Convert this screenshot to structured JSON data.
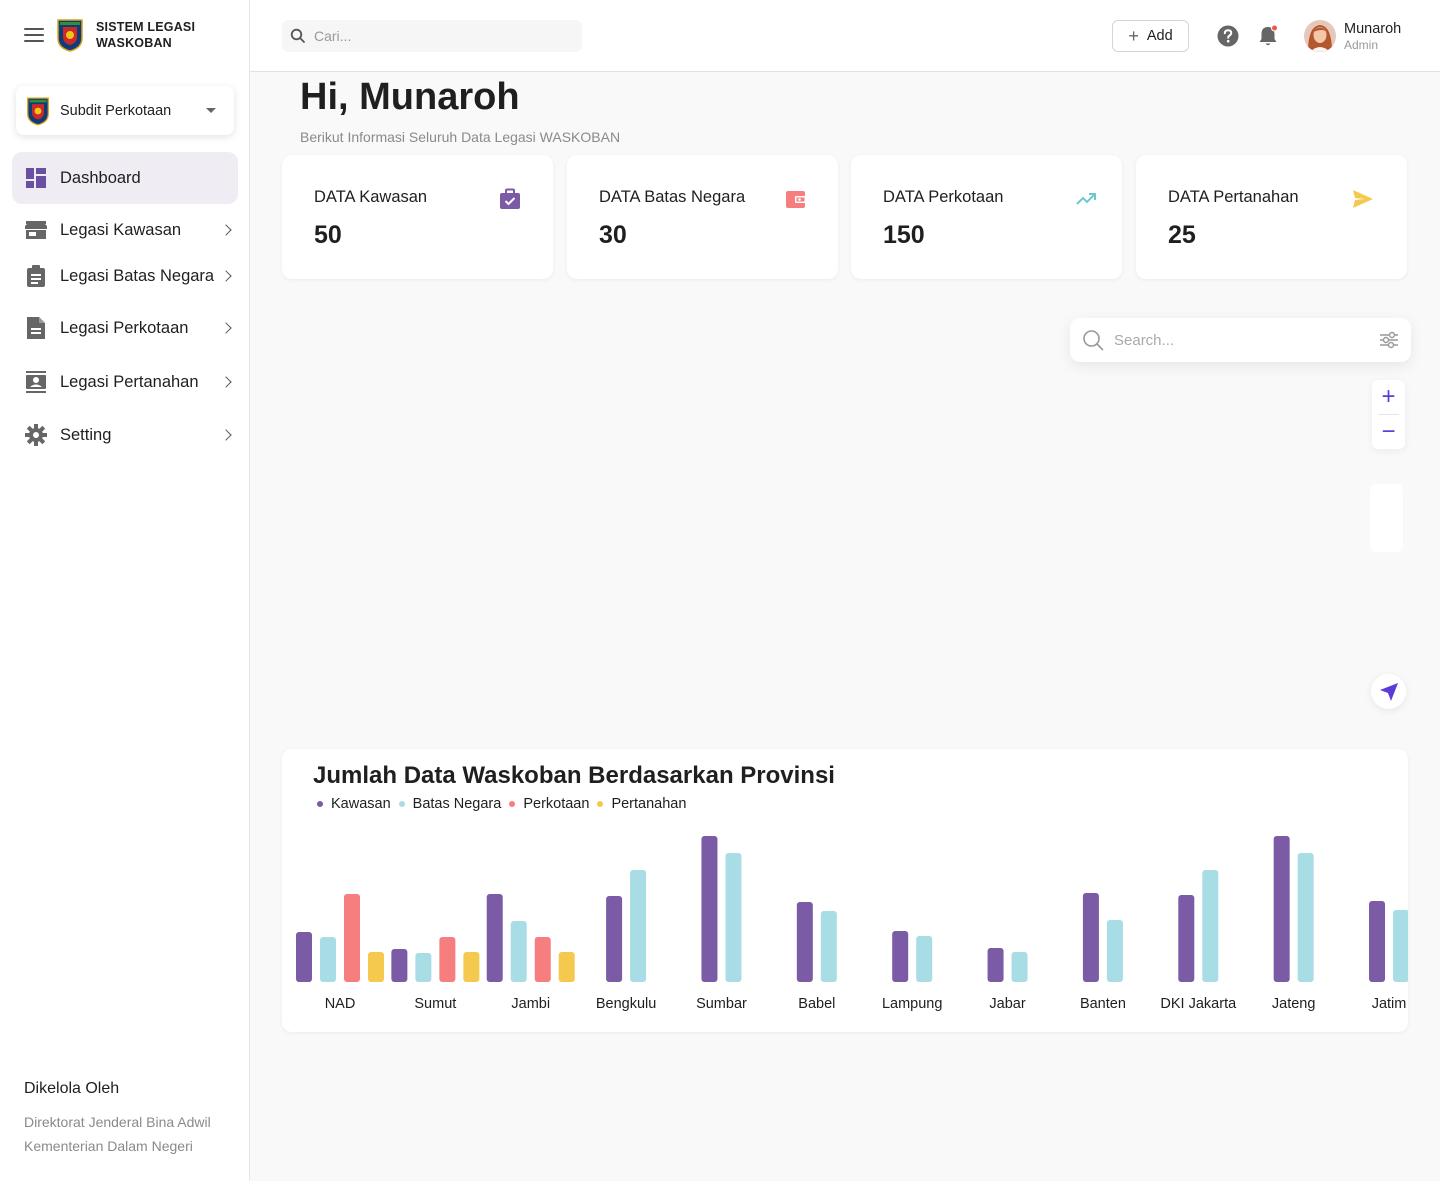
{
  "brand": {
    "line1": "SISTEM LEGASI",
    "line2": "WASKOBAN"
  },
  "subdit": {
    "label": "Subdit Perkotaan"
  },
  "nav": [
    {
      "label": "Dashboard",
      "icon": "dashboard-icon",
      "active": true
    },
    {
      "label": "Legasi Kawasan",
      "icon": "store-icon"
    },
    {
      "label": "Legasi Batas Negara",
      "icon": "clipboard-icon"
    },
    {
      "label": "Legasi Perkotaan",
      "icon": "document-icon"
    },
    {
      "label": "Legasi Pertanahan",
      "icon": "contact-icon"
    },
    {
      "label": "Setting",
      "icon": "gear-icon"
    }
  ],
  "footer": {
    "title": "Dikelola Oleh",
    "line1": "Direktorat Jenderal Bina Adwil",
    "line2": "Kementerian Dalam Negeri"
  },
  "topbar": {
    "search_placeholder": "Cari...",
    "add_label": "Add",
    "user_name": "Munaroh",
    "user_role": "Admin"
  },
  "greeting": {
    "title": "Hi, Munaroh",
    "subtitle": "Berikut Informasi Seluruh Data Legasi WASKOBAN"
  },
  "cards": [
    {
      "label": "DATA Kawasan",
      "value": "50",
      "icon": "briefcase-check-icon",
      "color": "#7b5aa6"
    },
    {
      "label": "DATA Batas Negara",
      "value": "30",
      "icon": "wallet-icon",
      "color": "#f77e7e"
    },
    {
      "label": "DATA Perkotaan",
      "value": "150",
      "icon": "trending-up-icon",
      "color": "#6cc9cf"
    },
    {
      "label": "DATA Pertanahan",
      "value": "25",
      "icon": "send-icon",
      "color": "#f5c94e"
    }
  ],
  "map": {
    "search_placeholder": "Search...",
    "zoom_in": "+",
    "zoom_out": "−"
  },
  "chart_data": {
    "type": "bar",
    "title": "Jumlah Data Waskoban Berdasarkan Provinsi",
    "categories": [
      "NAD",
      "Sumut",
      "Jambi",
      "Bengkulu",
      "Sumbar",
      "Babel",
      "Lampung",
      "Jabar",
      "Banten",
      "DKI Jakarta",
      "Jateng",
      "Jatim"
    ],
    "series": [
      {
        "name": "Kawasan",
        "color": "#7b5aa6",
        "values": [
          50,
          33,
          88,
          86,
          146,
          80,
          51,
          34,
          89,
          87,
          146,
          81
        ]
      },
      {
        "name": "Batas Negara",
        "color": "#a8dde6",
        "values": [
          45,
          29,
          61,
          112,
          129,
          71,
          46,
          30,
          62,
          112,
          129,
          72
        ]
      },
      {
        "name": "Perkotaan",
        "color": "#f77e7e",
        "values": [
          88,
          45,
          45,
          null,
          null,
          null,
          null,
          null,
          null,
          null,
          null,
          null
        ]
      },
      {
        "name": "Pertanahan",
        "color": "#f5c94e",
        "values": [
          30,
          30,
          30,
          null,
          null,
          null,
          null,
          null,
          null,
          null,
          null,
          null
        ]
      }
    ],
    "grid": false,
    "legend": "top-left"
  }
}
